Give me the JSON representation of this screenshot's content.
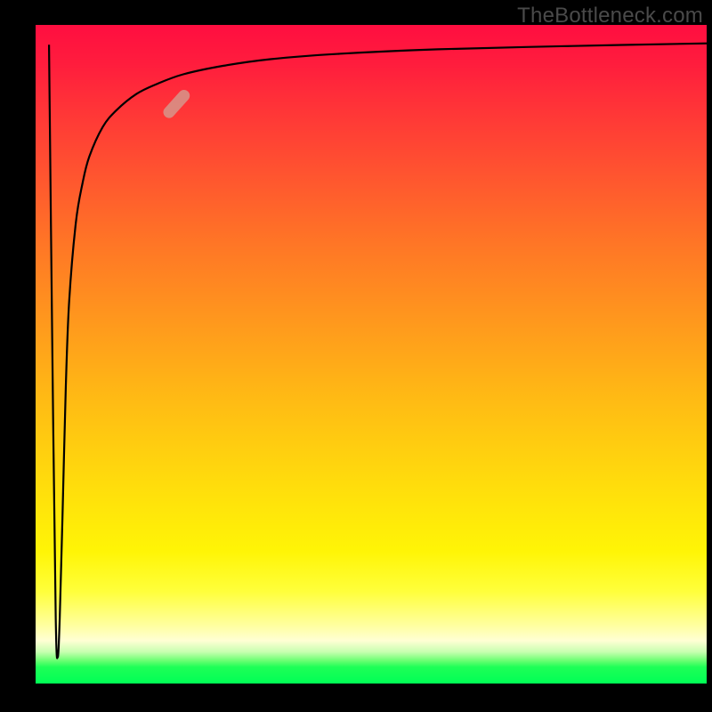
{
  "watermark": "TheBottleneck.com",
  "chart_data": {
    "type": "line",
    "title": "",
    "xlabel": "",
    "ylabel": "",
    "xlim": [
      0,
      100
    ],
    "ylim": [
      0,
      100
    ],
    "grid": false,
    "series": [
      {
        "name": "curve",
        "x": [
          2.0,
          2.5,
          3.0,
          3.3,
          3.6,
          4.0,
          4.5,
          5.0,
          6.0,
          7.0,
          8.0,
          10.0,
          12.0,
          15.0,
          18.0,
          22.0,
          28.0,
          35.0,
          45.0,
          60.0,
          80.0,
          100.0
        ],
        "y": [
          97,
          50,
          10,
          4,
          10,
          25,
          45,
          58,
          70,
          76,
          80,
          84.5,
          87,
          89.5,
          91,
          92.5,
          93.8,
          94.8,
          95.6,
          96.3,
          96.8,
          97.2
        ]
      }
    ],
    "marker": {
      "x": 21,
      "y": 88,
      "angle_deg": -48,
      "color": "#d49a8e"
    },
    "gradient_stops": [
      {
        "pos": 0.0,
        "color": "#ff0e40"
      },
      {
        "pos": 0.33,
        "color": "#ff981d"
      },
      {
        "pos": 0.7,
        "color": "#ffdd0c"
      },
      {
        "pos": 0.935,
        "color": "#ffffd4"
      },
      {
        "pos": 0.975,
        "color": "#1eff57"
      },
      {
        "pos": 1.0,
        "color": "#00ff55"
      }
    ]
  }
}
